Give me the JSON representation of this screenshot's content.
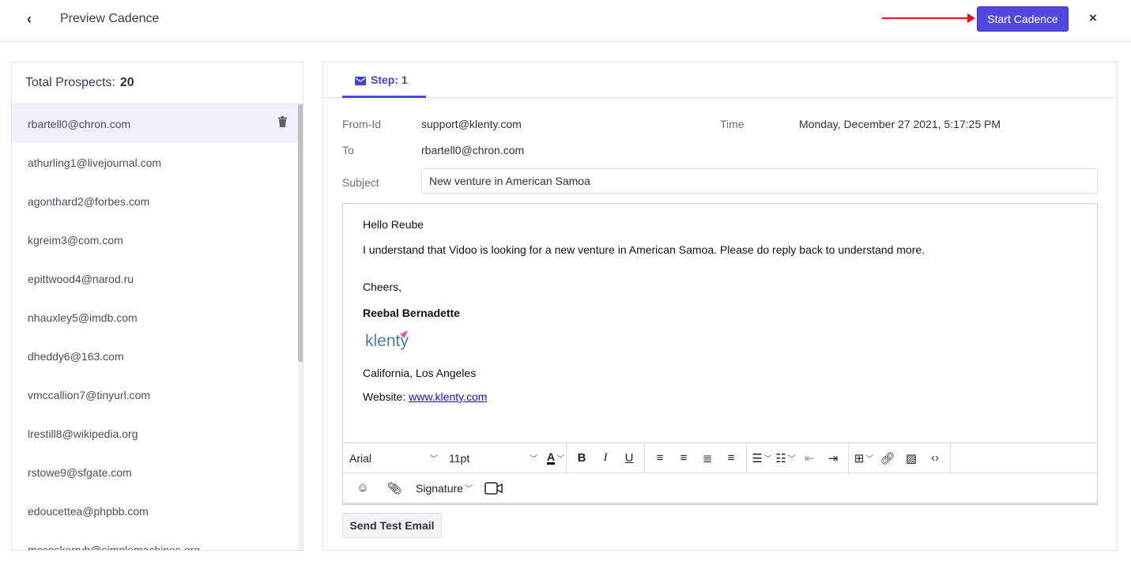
{
  "header": {
    "title": "Preview Cadence",
    "start_label": "Start Cadence",
    "close": "×",
    "back": "‹"
  },
  "prospects": {
    "label": "Total Prospects:",
    "count": "20",
    "items": [
      "rbartell0@chron.com",
      "athurling1@livejournal.com",
      "agonthard2@forbes.com",
      "kgreim3@com.com",
      "epittwood4@narod.ru",
      "nhauxley5@imdb.com",
      "dheddy6@163.com",
      "vmccallion7@tinyurl.com",
      "lrestill8@wikipedia.org",
      "rstowe9@sfgate.com",
      "edoucettea@phpbb.com",
      "mccoskerryb@simplemachines.org"
    ]
  },
  "email": {
    "tab": "Step: 1",
    "from_label": "From-Id",
    "from": "support@klenty.com",
    "time_label": "Time",
    "time": "Monday, December 27 2021, 5:17:25 PM",
    "to_label": "To",
    "to": "rbartell0@chron.com",
    "subject_label": "Subject",
    "subject": "New venture in American Samoa",
    "body": {
      "greeting": "Hello Reube",
      "line": "I understand that Vidoo is looking for a new venture in American Samoa. Please do reply back to understand more.",
      "closing": "Cheers,",
      "name": "Reebal Bernadette",
      "logo": "klenty",
      "location": "California, Los Angeles",
      "website_label": "Website:",
      "website": "www.klenty.com"
    }
  },
  "toolbar": {
    "font": "Arial",
    "size": "11pt",
    "signature": "Signature",
    "send_test": "Send Test Email"
  },
  "colors": {
    "accent": "#5148e0",
    "selected_row": "#f1f0fb",
    "arrow": "#ee1111"
  }
}
